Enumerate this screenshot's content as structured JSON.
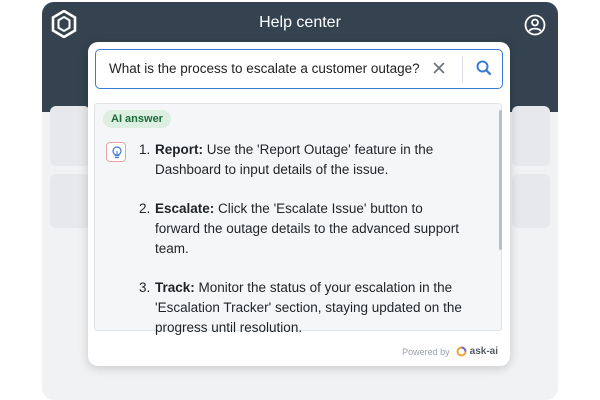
{
  "header": {
    "title": "Help center",
    "logo_icon": "hexagon-logo-icon",
    "profile_icon": "user-circle-icon"
  },
  "search": {
    "value": "What is the process to escalate a customer outage?",
    "clear_icon": "close-icon",
    "search_icon": "search-icon"
  },
  "answer": {
    "badge": "AI answer",
    "icon": "lightbulb-icon",
    "items": [
      {
        "number": "1.",
        "title": "Report:",
        "text": " Use the 'Report Outage' feature in the Dashboard to input details of the issue."
      },
      {
        "number": "2.",
        "title": "Escalate:",
        "text": " Click the 'Escalate Issue' button to forward the outage details to the advanced support team."
      },
      {
        "number": "3.",
        "title": "Track:",
        "text": " Monitor the status of your escalation in the 'Escalation Tracker' section, staying updated on the progress until resolution."
      }
    ]
  },
  "footer": {
    "powered_by": "Powered by",
    "brand": "ask-ai"
  },
  "colors": {
    "header_bg": "#34434f",
    "accent": "#3a7bd5",
    "badge_bg": "#dcefe0",
    "badge_text": "#1d6b3b"
  }
}
